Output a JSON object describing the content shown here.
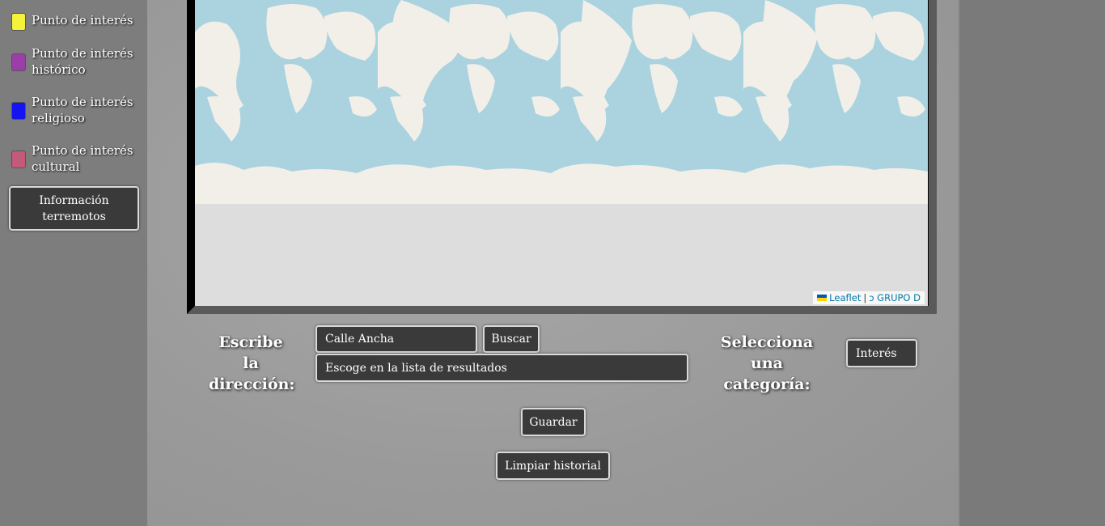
{
  "legend": [
    {
      "label_line1": "Punto de interés",
      "label_line2": "",
      "color": "#f5f23a"
    },
    {
      "label_line1": "Punto de interés",
      "label_line2": "histórico",
      "color": "#9b3fa8"
    },
    {
      "label_line1": "Punto de interés",
      "label_line2": "religioso",
      "color": "#1414f0"
    },
    {
      "label_line1": "Punto de interés",
      "label_line2": "cultural",
      "color": "#c45a7a"
    }
  ],
  "sidebar": {
    "info_button_label": "Información terremotos"
  },
  "map": {
    "attribution_leaflet": "Leaflet",
    "attribution_separator": "|",
    "attribution_copyright": "ↄ GRUPO D",
    "ocean_color": "#aad3df",
    "land_color": "#f2efe9",
    "empty_color": "#dddddd"
  },
  "form": {
    "address_label_line1": "Escribe la",
    "address_label_line2": "dirección:",
    "address_value": "Calle Ancha",
    "search_button": "Buscar",
    "results_select": "Escoge en la lista de resultados",
    "category_label_line1": "Selecciona una",
    "category_label_line2": "categoría:",
    "category_value": "Interés",
    "save_button": "Guardar",
    "clear_button": "Limpiar historial"
  }
}
